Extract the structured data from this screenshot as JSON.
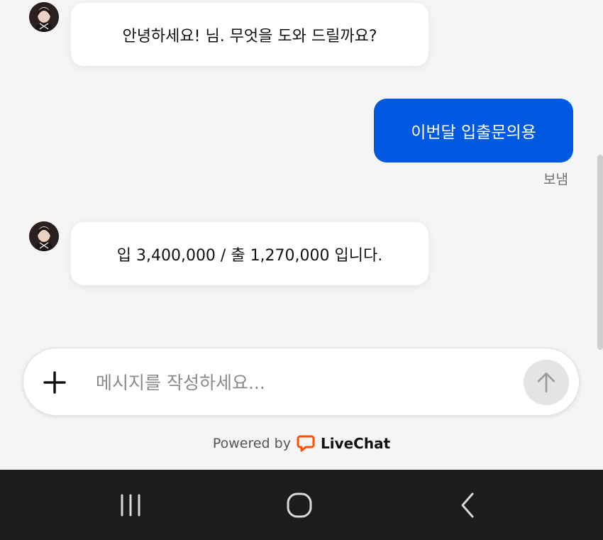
{
  "messages": [
    {
      "sender": "agent",
      "text": "안녕하세요! 님. 무엇을 도와 드릴까요?"
    },
    {
      "sender": "user",
      "text": "이번달 입출문의용",
      "status": "보냄"
    },
    {
      "sender": "agent",
      "text": "입 3,400,000 / 출 1,270,000 입니다."
    }
  ],
  "composer": {
    "placeholder": "메시지를 작성하세요...",
    "attach_icon": "plus-icon",
    "send_icon": "arrow-up-icon"
  },
  "footer": {
    "powered_by": "Powered by",
    "brand": "LiveChat",
    "brand_color": "#ff5100"
  },
  "nav": {
    "icons": [
      "recent-apps-icon",
      "home-icon",
      "back-icon"
    ]
  },
  "colors": {
    "user_bubble": "#0059e0",
    "background": "#f5f5f6",
    "navbar": "#1c1c1e"
  }
}
